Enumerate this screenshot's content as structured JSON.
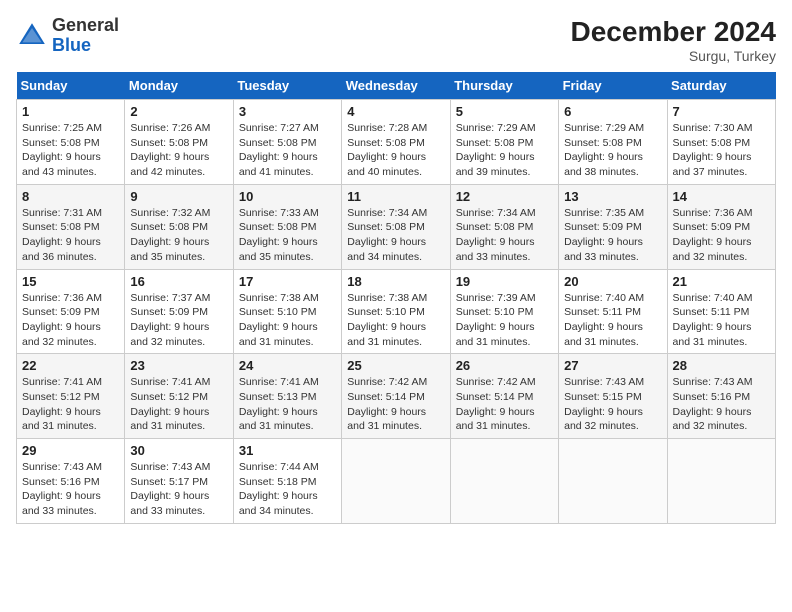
{
  "header": {
    "logo_general": "General",
    "logo_blue": "Blue",
    "month_year": "December 2024",
    "location": "Surgu, Turkey"
  },
  "weekdays": [
    "Sunday",
    "Monday",
    "Tuesday",
    "Wednesday",
    "Thursday",
    "Friday",
    "Saturday"
  ],
  "weeks": [
    [
      {
        "day": "1",
        "sunrise": "Sunrise: 7:25 AM",
        "sunset": "Sunset: 5:08 PM",
        "daylight": "Daylight: 9 hours and 43 minutes."
      },
      {
        "day": "2",
        "sunrise": "Sunrise: 7:26 AM",
        "sunset": "Sunset: 5:08 PM",
        "daylight": "Daylight: 9 hours and 42 minutes."
      },
      {
        "day": "3",
        "sunrise": "Sunrise: 7:27 AM",
        "sunset": "Sunset: 5:08 PM",
        "daylight": "Daylight: 9 hours and 41 minutes."
      },
      {
        "day": "4",
        "sunrise": "Sunrise: 7:28 AM",
        "sunset": "Sunset: 5:08 PM",
        "daylight": "Daylight: 9 hours and 40 minutes."
      },
      {
        "day": "5",
        "sunrise": "Sunrise: 7:29 AM",
        "sunset": "Sunset: 5:08 PM",
        "daylight": "Daylight: 9 hours and 39 minutes."
      },
      {
        "day": "6",
        "sunrise": "Sunrise: 7:29 AM",
        "sunset": "Sunset: 5:08 PM",
        "daylight": "Daylight: 9 hours and 38 minutes."
      },
      {
        "day": "7",
        "sunrise": "Sunrise: 7:30 AM",
        "sunset": "Sunset: 5:08 PM",
        "daylight": "Daylight: 9 hours and 37 minutes."
      }
    ],
    [
      {
        "day": "8",
        "sunrise": "Sunrise: 7:31 AM",
        "sunset": "Sunset: 5:08 PM",
        "daylight": "Daylight: 9 hours and 36 minutes."
      },
      {
        "day": "9",
        "sunrise": "Sunrise: 7:32 AM",
        "sunset": "Sunset: 5:08 PM",
        "daylight": "Daylight: 9 hours and 35 minutes."
      },
      {
        "day": "10",
        "sunrise": "Sunrise: 7:33 AM",
        "sunset": "Sunset: 5:08 PM",
        "daylight": "Daylight: 9 hours and 35 minutes."
      },
      {
        "day": "11",
        "sunrise": "Sunrise: 7:34 AM",
        "sunset": "Sunset: 5:08 PM",
        "daylight": "Daylight: 9 hours and 34 minutes."
      },
      {
        "day": "12",
        "sunrise": "Sunrise: 7:34 AM",
        "sunset": "Sunset: 5:08 PM",
        "daylight": "Daylight: 9 hours and 33 minutes."
      },
      {
        "day": "13",
        "sunrise": "Sunrise: 7:35 AM",
        "sunset": "Sunset: 5:09 PM",
        "daylight": "Daylight: 9 hours and 33 minutes."
      },
      {
        "day": "14",
        "sunrise": "Sunrise: 7:36 AM",
        "sunset": "Sunset: 5:09 PM",
        "daylight": "Daylight: 9 hours and 32 minutes."
      }
    ],
    [
      {
        "day": "15",
        "sunrise": "Sunrise: 7:36 AM",
        "sunset": "Sunset: 5:09 PM",
        "daylight": "Daylight: 9 hours and 32 minutes."
      },
      {
        "day": "16",
        "sunrise": "Sunrise: 7:37 AM",
        "sunset": "Sunset: 5:09 PM",
        "daylight": "Daylight: 9 hours and 32 minutes."
      },
      {
        "day": "17",
        "sunrise": "Sunrise: 7:38 AM",
        "sunset": "Sunset: 5:10 PM",
        "daylight": "Daylight: 9 hours and 31 minutes."
      },
      {
        "day": "18",
        "sunrise": "Sunrise: 7:38 AM",
        "sunset": "Sunset: 5:10 PM",
        "daylight": "Daylight: 9 hours and 31 minutes."
      },
      {
        "day": "19",
        "sunrise": "Sunrise: 7:39 AM",
        "sunset": "Sunset: 5:10 PM",
        "daylight": "Daylight: 9 hours and 31 minutes."
      },
      {
        "day": "20",
        "sunrise": "Sunrise: 7:40 AM",
        "sunset": "Sunset: 5:11 PM",
        "daylight": "Daylight: 9 hours and 31 minutes."
      },
      {
        "day": "21",
        "sunrise": "Sunrise: 7:40 AM",
        "sunset": "Sunset: 5:11 PM",
        "daylight": "Daylight: 9 hours and 31 minutes."
      }
    ],
    [
      {
        "day": "22",
        "sunrise": "Sunrise: 7:41 AM",
        "sunset": "Sunset: 5:12 PM",
        "daylight": "Daylight: 9 hours and 31 minutes."
      },
      {
        "day": "23",
        "sunrise": "Sunrise: 7:41 AM",
        "sunset": "Sunset: 5:12 PM",
        "daylight": "Daylight: 9 hours and 31 minutes."
      },
      {
        "day": "24",
        "sunrise": "Sunrise: 7:41 AM",
        "sunset": "Sunset: 5:13 PM",
        "daylight": "Daylight: 9 hours and 31 minutes."
      },
      {
        "day": "25",
        "sunrise": "Sunrise: 7:42 AM",
        "sunset": "Sunset: 5:14 PM",
        "daylight": "Daylight: 9 hours and 31 minutes."
      },
      {
        "day": "26",
        "sunrise": "Sunrise: 7:42 AM",
        "sunset": "Sunset: 5:14 PM",
        "daylight": "Daylight: 9 hours and 31 minutes."
      },
      {
        "day": "27",
        "sunrise": "Sunrise: 7:43 AM",
        "sunset": "Sunset: 5:15 PM",
        "daylight": "Daylight: 9 hours and 32 minutes."
      },
      {
        "day": "28",
        "sunrise": "Sunrise: 7:43 AM",
        "sunset": "Sunset: 5:16 PM",
        "daylight": "Daylight: 9 hours and 32 minutes."
      }
    ],
    [
      {
        "day": "29",
        "sunrise": "Sunrise: 7:43 AM",
        "sunset": "Sunset: 5:16 PM",
        "daylight": "Daylight: 9 hours and 33 minutes."
      },
      {
        "day": "30",
        "sunrise": "Sunrise: 7:43 AM",
        "sunset": "Sunset: 5:17 PM",
        "daylight": "Daylight: 9 hours and 33 minutes."
      },
      {
        "day": "31",
        "sunrise": "Sunrise: 7:44 AM",
        "sunset": "Sunset: 5:18 PM",
        "daylight": "Daylight: 9 hours and 34 minutes."
      },
      null,
      null,
      null,
      null
    ]
  ]
}
